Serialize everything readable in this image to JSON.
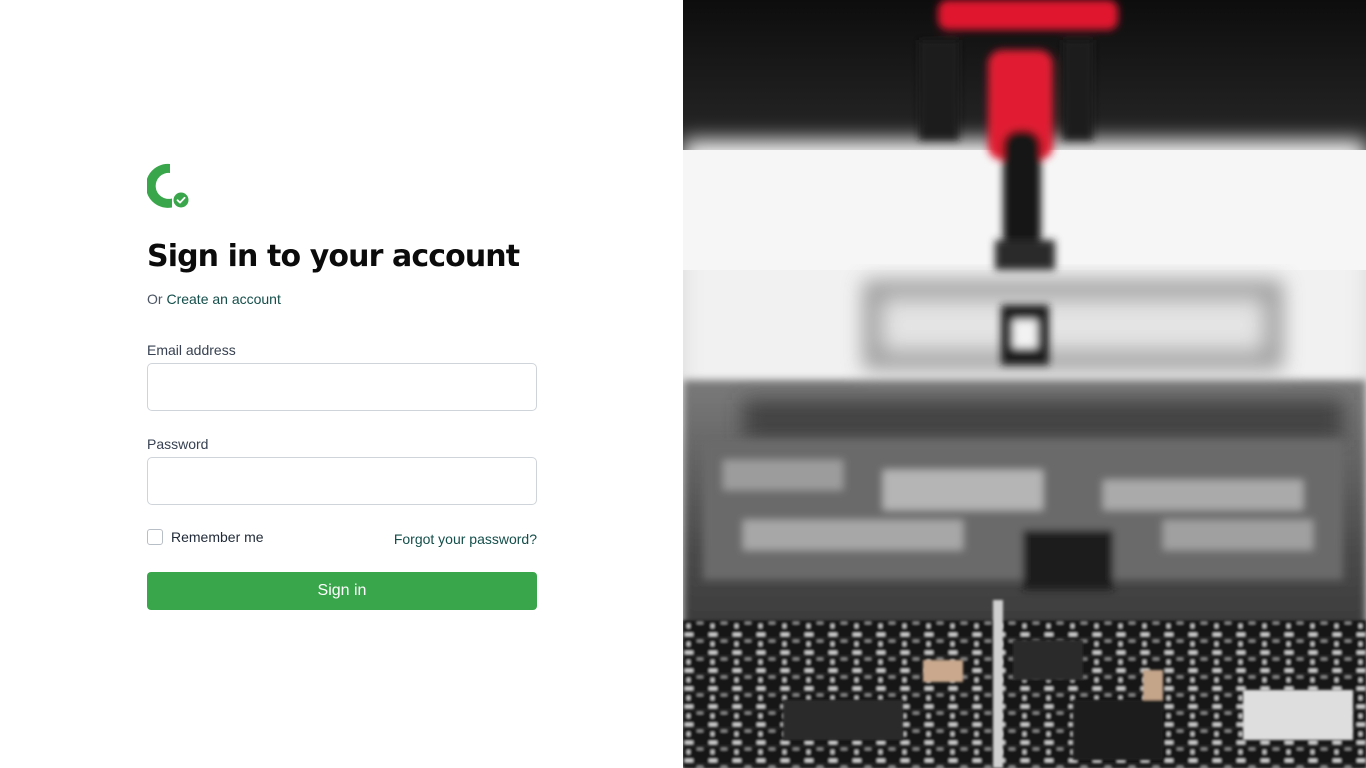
{
  "login": {
    "heading": "Sign in to your account",
    "subtitle_prefix": "Or",
    "create_account_link": "Create an account",
    "email_label": "Email address",
    "email_value": "",
    "password_label": "Password",
    "password_value": "",
    "remember_label": "Remember me",
    "remember_checked": false,
    "forgot_link": "Forgot your password?",
    "submit_label": "Sign in"
  },
  "brand": {
    "logo_icon": "c-check-logo-icon",
    "accent_color": "#3aa64b",
    "link_color": "#134e4a"
  },
  "hero": {
    "icon": "circuit-board-photo"
  }
}
